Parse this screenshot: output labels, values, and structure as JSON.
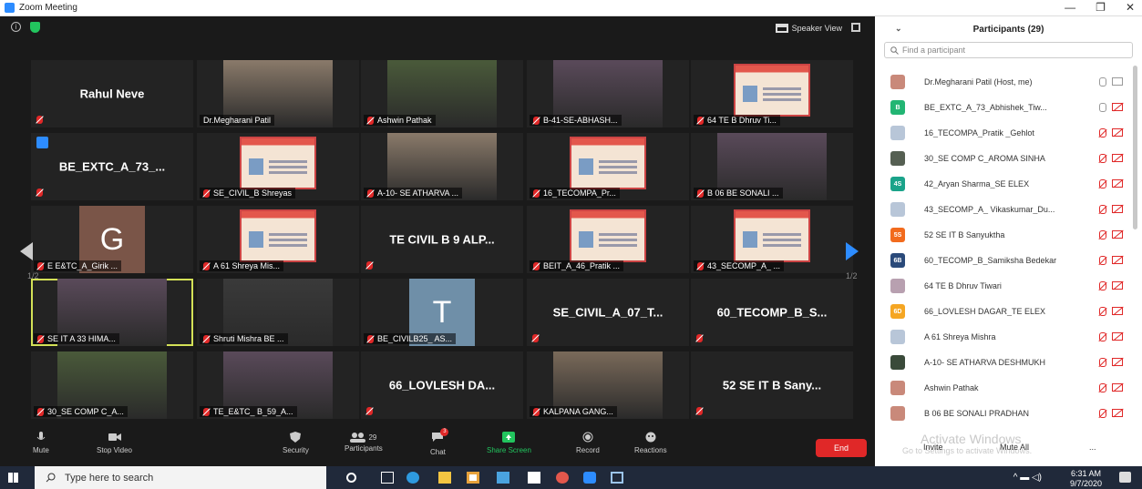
{
  "window": {
    "title": "Zoom Meeting",
    "min": "—",
    "max": "❐",
    "close": "✕"
  },
  "meeting": {
    "speaker_view_label": "Speaker View",
    "page_left": "1/2",
    "page_right": "1/2",
    "tiles": [
      {
        "name": "Rahul Neve",
        "kind": "name"
      },
      {
        "name": "Dr.Megharani Patil",
        "kind": "photo"
      },
      {
        "name": "Ashwin Pathak",
        "kind": "photo"
      },
      {
        "name": "B-41-SE-ABHASH...",
        "kind": "photo"
      },
      {
        "name": "64 TE B Dhruv Ti...",
        "kind": "card"
      },
      {
        "name": "BE_EXTC_A_73_...",
        "kind": "name"
      },
      {
        "name": "SE_CIVIL_B Shreyas",
        "kind": "card"
      },
      {
        "name": "A-10- SE ATHARVA ...",
        "kind": "photo"
      },
      {
        "name": "16_TECOMPA_Pr...",
        "kind": "card"
      },
      {
        "name": "B 06 BE SONALI ...",
        "kind": "photo"
      },
      {
        "name": "E E&TC_A_Girik ...",
        "kind": "avatar",
        "letter": "G"
      },
      {
        "name": "A 61 Shreya Mis...",
        "kind": "card"
      },
      {
        "name": "TE CIVIL B 9 ALP...",
        "kind": "name"
      },
      {
        "name": "BEIT_A_46_Pratik ...",
        "kind": "card"
      },
      {
        "name": "43_SECOMP_A_ ...",
        "kind": "card"
      },
      {
        "name": "SE IT A 33 HIMA...",
        "kind": "photo"
      },
      {
        "name": "Shruti Mishra BE ...",
        "kind": "photo"
      },
      {
        "name": "BE_CIVILB25_ AS...",
        "kind": "avatar",
        "letter": "T"
      },
      {
        "name": "SE_CIVIL_A_07_T...",
        "kind": "name"
      },
      {
        "name": "60_TECOMP_B_S...",
        "kind": "name"
      },
      {
        "name": "30_SE COMP C_A...",
        "kind": "photo"
      },
      {
        "name": "TE_E&TC_ B_59_A...",
        "kind": "photo"
      },
      {
        "name": "66_LOVLESH DA...",
        "kind": "name"
      },
      {
        "name": "KALPANA GANG...",
        "kind": "photo"
      },
      {
        "name": "52 SE IT B Sany...",
        "kind": "name"
      }
    ]
  },
  "toolbar": {
    "mute": "Mute",
    "stop_video": "Stop Video",
    "security": "Security",
    "participants": "Participants",
    "participants_count": "29",
    "chat": "Chat",
    "chat_badge": "3",
    "share_screen": "Share Screen",
    "record": "Record",
    "reactions": "Reactions",
    "end": "End"
  },
  "participants_panel": {
    "title": "Participants (29)",
    "search_placeholder": "Find a participant",
    "items": [
      {
        "name": "Dr.Megharani Patil (Host, me)",
        "avatar": "",
        "color": "#c9897a"
      },
      {
        "name": "BE_EXTC_A_73_Abhishek_Tiw...",
        "avatar": "B",
        "color": "#22b573"
      },
      {
        "name": "16_TECOMPA_Pratik _Gehlot",
        "avatar": "",
        "color": "#b8c6d8"
      },
      {
        "name": "30_SE COMP C_AROMA SINHA",
        "avatar": "",
        "color": "#555f52"
      },
      {
        "name": "42_Aryan Sharma_SE ELEX",
        "avatar": "4S",
        "color": "#1aa38a"
      },
      {
        "name": "43_SECOMP_A_ Vikaskumar_Du...",
        "avatar": "",
        "color": "#b8c6d8"
      },
      {
        "name": "52 SE IT B Sanyuktha",
        "avatar": "5S",
        "color": "#f26b1d"
      },
      {
        "name": "60_TECOMP_B_Samiksha Bedekar",
        "avatar": "6B",
        "color": "#2a4a7a"
      },
      {
        "name": "64 TE B Dhruv Tiwari",
        "avatar": "",
        "color": "#b8a0b0"
      },
      {
        "name": "66_LOVLESH DAGAR_TE ELEX",
        "avatar": "6D",
        "color": "#f5a623"
      },
      {
        "name": "A 61 Shreya Mishra",
        "avatar": "",
        "color": "#b8c6d8"
      },
      {
        "name": "A-10- SE ATHARVA DESHMUKH",
        "avatar": "",
        "color": "#3a4a3a"
      },
      {
        "name": "Ashwin Pathak",
        "avatar": "",
        "color": "#c9897a"
      },
      {
        "name": "B 06 BE SONALI PRADHAN",
        "avatar": "",
        "color": "#c9897a"
      }
    ],
    "watermark_line1": "Activate Windows",
    "watermark_line2": "Go to Settings to activate Windows.",
    "invite": "Invite",
    "mute_all": "Mute All",
    "more": "..."
  },
  "taskbar": {
    "search_placeholder": "Type here to search",
    "time": "6:31 AM",
    "date": "9/7/2020"
  }
}
